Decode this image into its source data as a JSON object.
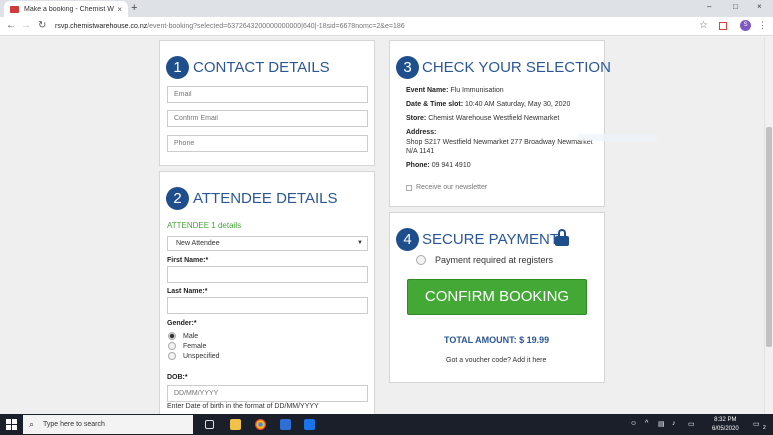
{
  "browser": {
    "tab_title": "Make a booking - Chemist Ware",
    "tab_close": "×",
    "new_tab": "+",
    "url_host": "rsvp.chemistwarehouse.co.nz",
    "url_path": "/event-booking?selected=6372643200000000000|640|-18sid=6678nomc=2&e=186",
    "win_min": "–",
    "win_max": "□",
    "win_close": "×",
    "profile_initial": "S"
  },
  "contact": {
    "step": "1",
    "title": "CONTACT DETAILS",
    "email_placeholder": "Email",
    "confirm_email_placeholder": "Confirm Email",
    "phone_placeholder": "Phone"
  },
  "attendee": {
    "step": "2",
    "title": "ATTENDEE DETAILS",
    "subtitle": "ATTENDEE 1 details",
    "select_value": "New Attendee",
    "first_name_label": "First Name:*",
    "last_name_label": "Last Name:*",
    "gender_label": "Gender:*",
    "gender_options": [
      "Male",
      "Female",
      "Unspecified"
    ],
    "dob_label": "DOB:*",
    "dob_placeholder": "DD/MM/YYYY",
    "dob_hint": "Enter Date of birth in the format of DD/MM/YYYY"
  },
  "selection": {
    "step": "3",
    "title": "CHECK YOUR SELECTION",
    "event_label": "Event Name:",
    "event_value": "Flu Immunisation",
    "datetime_label": "Date & Time slot:",
    "datetime_value": "10:40 AM Saturday, May 30, 2020",
    "store_label": "Store:",
    "store_value": "Chemist Warehouse Westfield Newmarket",
    "address_label": "Address:",
    "address_line1": "Shop S217 Westfield Newmarket 277 Broadway Newmarket",
    "address_line2": "N/A 1141",
    "phone_label": "Phone:",
    "phone_value": "09 941 4910",
    "newsletter_label": "Receive our newsletter"
  },
  "payment": {
    "step": "4",
    "title": "SECURE PAYMENT",
    "option_label": "Payment required at registers",
    "confirm_label": "CONFIRM BOOKING",
    "total_label": "TOTAL AMOUNT: $ 19.99",
    "voucher_text": "Got a voucher code? Add it here"
  },
  "taskbar": {
    "search_placeholder": "Type here to search",
    "time": "8:32 PM",
    "date": "6/05/2020",
    "notification_count": "2"
  },
  "colors": {
    "brand_blue": "#1f4e8c",
    "title_blue": "#2b5797",
    "confirm_green": "#43a835",
    "attendee_green": "#4aa13c"
  }
}
